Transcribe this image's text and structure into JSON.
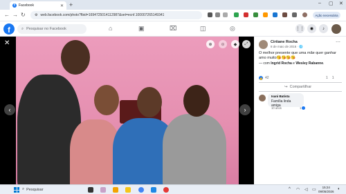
{
  "browser": {
    "tab_title": "Facebook",
    "url": "web.facebook.com/photo?fbid=1694725014112987&set=ecnf.100007265149341",
    "update_label": "Ação necessária"
  },
  "facebook": {
    "search_placeholder": "Pesquisar no Facebook"
  },
  "post": {
    "author": "Cirtiane Rocha",
    "date": "8 de maio de 2016 · ",
    "caption": "O melhor presente que uma mãe quer ganhar amo muito😘😘😘😘",
    "with_prefix": "— com ",
    "tagged1": "Ingrid Rocha",
    "with_and": " e ",
    "tagged2": "Wesley Rabanne",
    "with_suffix": ".",
    "reaction_count": "42",
    "comment_count": "1",
    "share_count": "1",
    "share_label": "Compartilhar"
  },
  "comment": {
    "author": "Isani Batista",
    "text": "Família linda amiga",
    "age": "10 anos",
    "likes": "1"
  },
  "taskbar": {
    "search_label": "Pesquisar",
    "time": "15:24",
    "date": "09/05/2026"
  },
  "colors": {
    "fb_blue": "#1877f2",
    "photo_wall": "#e58fb0"
  }
}
